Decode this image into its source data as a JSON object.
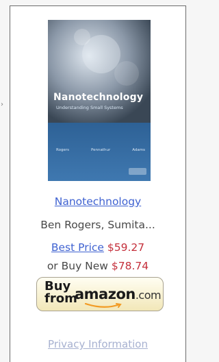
{
  "scroll_arrow": "›",
  "product": {
    "cover": {
      "title": "Nanotechnology",
      "subtitle": "Understanding Small Systems",
      "authors": [
        "Rogers",
        "Pennathur",
        "Adams"
      ]
    },
    "title_link": "Nanotechnology",
    "authors_text": "Ben Rogers, Sumita...",
    "best_price_label": "Best Price",
    "best_price_value": "$59.27",
    "buy_new_label": "or Buy New",
    "buy_new_value": "$78.74"
  },
  "button": {
    "buy": "Buy",
    "from": "from",
    "brand": "amazon",
    "brand_suffix": ".com"
  },
  "footer": {
    "privacy": "Privacy Information"
  },
  "colors": {
    "link_blue": "#3f62d1",
    "price_red": "#c42f3b",
    "border": "#6b6b6b"
  }
}
